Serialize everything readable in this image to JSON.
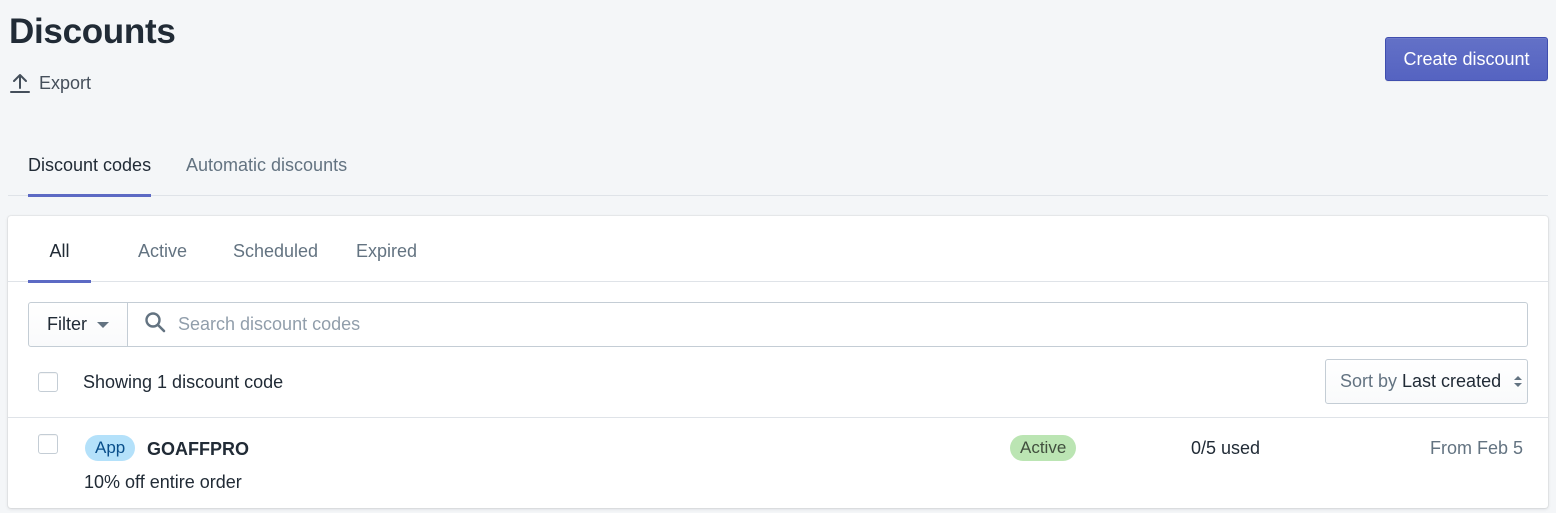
{
  "header": {
    "title": "Discounts",
    "export_label": "Export",
    "create_label": "Create discount"
  },
  "top_tabs": [
    {
      "label": "Discount codes",
      "active": true
    },
    {
      "label": "Automatic discounts",
      "active": false
    }
  ],
  "status_tabs": [
    {
      "label": "All",
      "active": true
    },
    {
      "label": "Active",
      "active": false
    },
    {
      "label": "Scheduled",
      "active": false
    },
    {
      "label": "Expired",
      "active": false
    }
  ],
  "filter": {
    "button_label": "Filter",
    "search_placeholder": "Search discount codes",
    "search_value": ""
  },
  "list_header": {
    "showing_text": "Showing 1 discount code",
    "sort_prefix": "Sort by",
    "sort_value": "Last created"
  },
  "discounts": [
    {
      "source_badge": "App",
      "code": "GOAFFPRO",
      "description": "10% off entire order",
      "status": "Active",
      "usage": "0/5 used",
      "date": "From Feb 5"
    }
  ],
  "colors": {
    "accent": "#5c6ac4",
    "app_badge_bg": "#b4e1fa",
    "active_badge_bg": "#bbe5b3",
    "page_bg": "#f4f6f8"
  },
  "icons": {
    "export": "upload-icon",
    "filter_caret": "caret-down-icon",
    "search": "search-icon",
    "sort": "sort-arrows-icon"
  }
}
